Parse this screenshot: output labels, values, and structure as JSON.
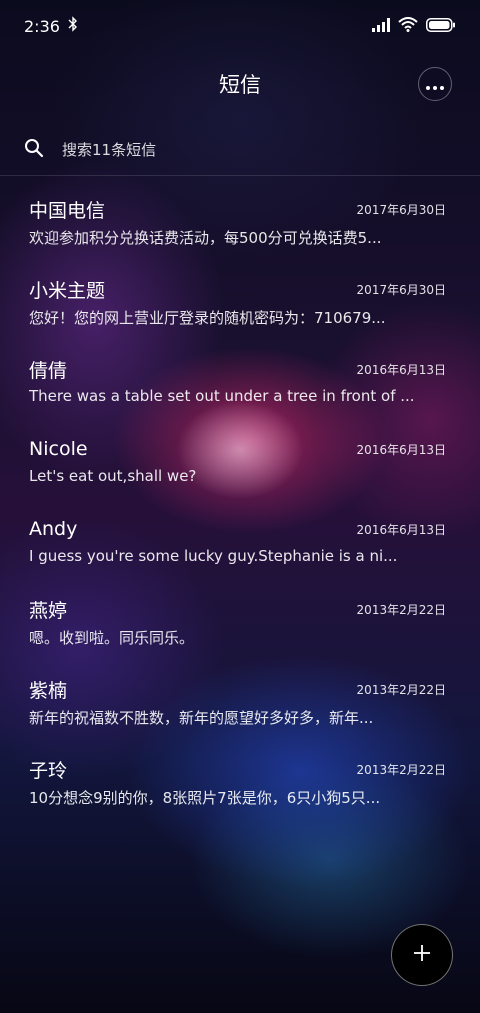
{
  "status_bar": {
    "time": "2:36",
    "icons": [
      "bluetooth-icon",
      "signal-icon",
      "wifi-icon",
      "battery-icon"
    ]
  },
  "header": {
    "title": "短信",
    "more_icon": "more-icon"
  },
  "search": {
    "icon": "search-icon",
    "placeholder": "搜索11条短信"
  },
  "conversations": [
    {
      "name": "中国电信",
      "date": "2017年6月30日",
      "preview": "欢迎参加积分兑换话费活动，每500分可兑换话费5..."
    },
    {
      "name": "小米主题",
      "date": "2017年6月30日",
      "preview": "您好！您的网上营业厅登录的随机密码为：710679..."
    },
    {
      "name": "倩倩",
      "date": "2016年6月13日",
      "preview": "There was a table set out under a tree in front of ..."
    },
    {
      "name": "Nicole",
      "date": "2016年6月13日",
      "preview": "Let's eat out,shall we?"
    },
    {
      "name": "Andy",
      "date": "2016年6月13日",
      "preview": "I guess you're some lucky guy.Stephanie is a ni..."
    },
    {
      "name": "燕婷",
      "date": "2013年2月22日",
      "preview": "嗯。收到啦。同乐同乐。"
    },
    {
      "name": "紫楠",
      "date": "2013年2月22日",
      "preview": "新年的祝福数不胜数，新年的愿望好多好多，新年..."
    },
    {
      "name": "子玲",
      "date": "2013年2月22日",
      "preview": "10分想念9别的你，8张照片7张是你，6只小狗5只..."
    }
  ],
  "fab": {
    "icon": "plus-icon"
  },
  "colors": {
    "text": "#ffffff",
    "background": "#0a0a1c"
  }
}
